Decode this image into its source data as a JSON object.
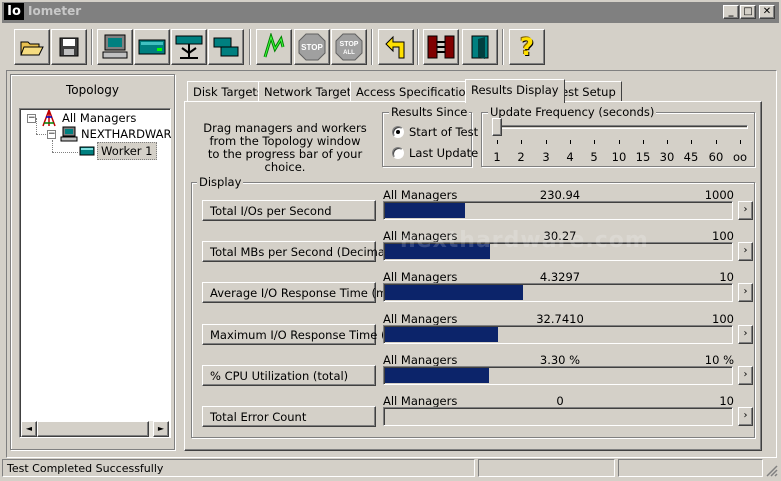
{
  "window": {
    "icon_text": "Io",
    "title": "Iometer"
  },
  "toolbar": [
    {
      "icon": "open-folder-icon"
    },
    {
      "icon": "save-disk-icon"
    },
    {
      "icon": "new-manager-icon"
    },
    {
      "icon": "new-disk-worker-icon"
    },
    {
      "icon": "new-network-worker-icon"
    },
    {
      "icon": "duplicate-worker-icon"
    },
    {
      "icon": "start-tests-icon"
    },
    {
      "icon": "stop-icon",
      "text": "STOP"
    },
    {
      "icon": "stop-all-icon",
      "text": "STOP",
      "text2": "ALL"
    },
    {
      "icon": "reset-workers-icon"
    },
    {
      "icon": "exit-icon"
    },
    {
      "icon": "help-icon",
      "text": "?"
    }
  ],
  "topology": {
    "title": "Topology",
    "root": "All Managers",
    "manager": "NEXTHARDWAR",
    "worker": "Worker 1"
  },
  "tabs": [
    "Disk Targets",
    "Network Targets",
    "Access Specifications",
    "Results Display",
    "Test Setup"
  ],
  "results": {
    "instructions": [
      "Drag managers and workers",
      "from the Topology window",
      "to the progress bar of your choice."
    ],
    "results_since": {
      "title": "Results Since",
      "options": [
        "Start of Test",
        "Last Update"
      ],
      "selected": 0
    },
    "update_frequency": {
      "title": "Update Frequency (seconds)",
      "ticks": [
        "1",
        "2",
        "3",
        "4",
        "5",
        "10",
        "15",
        "30",
        "45",
        "60",
        "oo"
      ],
      "selected_index": 0
    },
    "display_title": "Display",
    "metrics": [
      {
        "name": "Total I/Os per Second",
        "source": "All Managers",
        "value": "230.94",
        "max": "1000",
        "fraction": 0.2309
      },
      {
        "name": "Total MBs per Second (Decimal)",
        "source": "All Managers",
        "value": "30.27",
        "max": "100",
        "fraction": 0.3027
      },
      {
        "name": "Average I/O Response Time (ms)",
        "source": "All Managers",
        "value": "4.3297",
        "max": "10",
        "fraction": 0.4
      },
      {
        "name": "Maximum I/O Response Time (ms)",
        "source": "All Managers",
        "value": "32.7410",
        "max": "100",
        "fraction": 0.3274
      },
      {
        "name": "% CPU Utilization (total)",
        "source": "All Managers",
        "value": "3.30 %",
        "max": "10 %",
        "fraction": 0.3
      },
      {
        "name": "Total Error Count",
        "source": "All Managers",
        "value": "0",
        "max": "10",
        "fraction": 0
      }
    ]
  },
  "status": {
    "text": "Test Completed Successfully"
  },
  "watermark": "nexthardware.com"
}
